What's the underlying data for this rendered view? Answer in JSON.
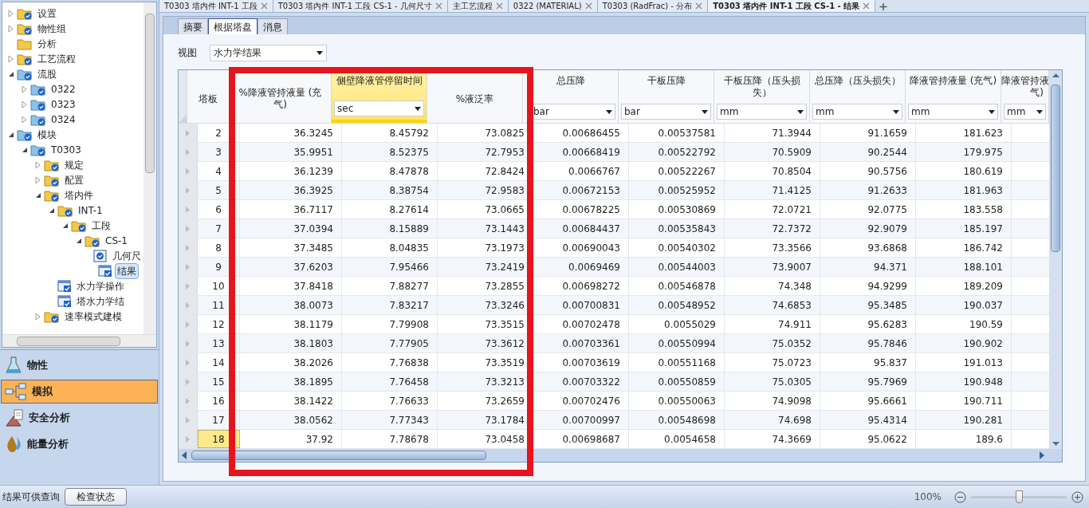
{
  "tree": [
    {
      "label": "设置",
      "kind": "folder-check",
      "expanded": false
    },
    {
      "label": "物性组",
      "kind": "folder-check",
      "expanded": false
    },
    {
      "label": "分析",
      "kind": "folder"
    },
    {
      "label": "工艺流程",
      "kind": "folder-check",
      "expanded": false
    },
    {
      "label": "流股",
      "kind": "folder-blue",
      "expanded": true,
      "children": [
        {
          "label": "0322",
          "kind": "folder-blue",
          "expanded": false
        },
        {
          "label": "0323",
          "kind": "folder-blue",
          "expanded": false
        },
        {
          "label": "0324",
          "kind": "folder-blue",
          "expanded": false
        }
      ]
    },
    {
      "label": "模块",
      "kind": "folder-blue",
      "expanded": true,
      "children": [
        {
          "label": "T0303",
          "kind": "folder-blue",
          "expanded": true,
          "children": [
            {
              "label": "规定",
              "kind": "folder-check",
              "expanded": false
            },
            {
              "label": "配置",
              "kind": "folder-check",
              "expanded": false
            },
            {
              "label": "塔内件",
              "kind": "folder-check",
              "expanded": true,
              "children": [
                {
                  "label": "INT-1",
                  "kind": "folder-check",
                  "expanded": true,
                  "children": [
                    {
                      "label": "工段",
                      "kind": "folder-check",
                      "expanded": true,
                      "children": [
                        {
                          "label": "CS-1",
                          "kind": "folder-check",
                          "expanded": true,
                          "children": [
                            {
                              "label": "几何尺",
                              "kind": "form",
                              "selected": false
                            },
                            {
                              "label": "结果",
                              "kind": "result",
                              "selected": true
                            }
                          ]
                        }
                      ]
                    }
                  ]
                },
                {
                  "label": "水力学操作",
                  "kind": "result",
                  "selected": false
                },
                {
                  "label": "塔水力学结",
                  "kind": "result",
                  "selected": false
                }
              ]
            },
            {
              "label": "速率模式建模",
              "kind": "folder-check",
              "expanded": false
            }
          ]
        }
      ]
    }
  ],
  "nav": [
    {
      "label": "物性",
      "kind": "flask",
      "selected": false
    },
    {
      "label": "模拟",
      "kind": "flowsheet",
      "selected": true
    },
    {
      "label": "安全分析",
      "kind": "safety",
      "selected": false
    },
    {
      "label": "能量分析",
      "kind": "energy",
      "selected": false
    }
  ],
  "doc_tabs": [
    {
      "label": "T0303 塔内件 INT-1 工段",
      "selected": false
    },
    {
      "label": "T0303 塔内件 INT-1 工段 CS-1 - 几何尺寸",
      "selected": false
    },
    {
      "label": "主工艺流程",
      "selected": false
    },
    {
      "label": "0322 (MATERIAL)",
      "selected": false
    },
    {
      "label": "T0303 (RadFrac) - 分布",
      "selected": false
    },
    {
      "label": "T0303 塔内件 INT-1 工段 CS-1 - 结果",
      "selected": true
    }
  ],
  "sub_tabs": [
    {
      "label": "摘要",
      "selected": false
    },
    {
      "label": "根据塔盘",
      "selected": true
    },
    {
      "label": "消息",
      "selected": false
    }
  ],
  "view": {
    "label": "视图",
    "value": "水力学结果"
  },
  "table": {
    "columns": [
      {
        "lines": [
          "塔板"
        ],
        "selected": false
      },
      {
        "lines": [
          "%降液管持液量 (充",
          "气)"
        ],
        "selected": false
      },
      {
        "lines": [
          "侧壁降液管停留时间"
        ],
        "unit": "sec",
        "selected": true
      },
      {
        "lines": [
          "%液泛率"
        ],
        "selected": false
      },
      {
        "lines": [
          "总压降"
        ],
        "unit": "bar",
        "selected": false
      },
      {
        "lines": [
          "干板压降"
        ],
        "unit": "bar",
        "selected": false
      },
      {
        "lines": [
          "干板压降（压头损",
          "失）"
        ],
        "unit": "mm",
        "selected": false
      },
      {
        "lines": [
          "总压降（压头损失）"
        ],
        "unit": "mm",
        "selected": false
      },
      {
        "lines": [
          "降液管持液量 (充气)"
        ],
        "unit": "mm",
        "selected": false
      },
      {
        "lines": [
          "降液管持液",
          "气)"
        ],
        "unit": "mm",
        "selected": false
      }
    ],
    "rows": [
      {
        "selected": false,
        "cells": [
          "2",
          "36.3245",
          "8.45792",
          "73.0825",
          "0.00686455",
          "0.00537581",
          "71.3944",
          "91.1659",
          "181.623"
        ]
      },
      {
        "selected": false,
        "cells": [
          "3",
          "35.9951",
          "8.52375",
          "72.7953",
          "0.00668419",
          "0.00522792",
          "70.5909",
          "90.2544",
          "179.975"
        ]
      },
      {
        "selected": false,
        "cells": [
          "4",
          "36.1239",
          "8.47878",
          "72.8424",
          "0.0066767",
          "0.00522267",
          "70.8504",
          "90.5756",
          "180.619"
        ]
      },
      {
        "selected": false,
        "cells": [
          "5",
          "36.3925",
          "8.38754",
          "72.9583",
          "0.00672153",
          "0.00525952",
          "71.4125",
          "91.2633",
          "181.963"
        ]
      },
      {
        "selected": false,
        "cells": [
          "6",
          "36.7117",
          "8.27614",
          "73.0665",
          "0.00678225",
          "0.00530869",
          "72.0721",
          "92.0775",
          "183.558"
        ]
      },
      {
        "selected": false,
        "cells": [
          "7",
          "37.0394",
          "8.15889",
          "73.1443",
          "0.00684437",
          "0.00535843",
          "72.7372",
          "92.9079",
          "185.197"
        ]
      },
      {
        "selected": false,
        "cells": [
          "8",
          "37.3485",
          "8.04835",
          "73.1973",
          "0.00690043",
          "0.00540302",
          "73.3566",
          "93.6868",
          "186.742"
        ]
      },
      {
        "selected": false,
        "cells": [
          "9",
          "37.6203",
          "7.95466",
          "73.2419",
          "0.0069469",
          "0.00544003",
          "73.9007",
          "94.371",
          "188.101"
        ]
      },
      {
        "selected": false,
        "cells": [
          "10",
          "37.8418",
          "7.88277",
          "73.2855",
          "0.00698272",
          "0.00546878",
          "74.348",
          "94.9299",
          "189.209"
        ]
      },
      {
        "selected": false,
        "cells": [
          "11",
          "38.0073",
          "7.83217",
          "73.3246",
          "0.00700831",
          "0.00548952",
          "74.6853",
          "95.3485",
          "190.037"
        ]
      },
      {
        "selected": false,
        "cells": [
          "12",
          "38.1179",
          "7.79908",
          "73.3515",
          "0.00702478",
          "0.0055029",
          "74.911",
          "95.6283",
          "190.59"
        ]
      },
      {
        "selected": false,
        "cells": [
          "13",
          "38.1803",
          "7.77905",
          "73.3612",
          "0.00703361",
          "0.00550994",
          "75.0352",
          "95.7846",
          "190.902"
        ]
      },
      {
        "selected": false,
        "cells": [
          "14",
          "38.2026",
          "7.76838",
          "73.3519",
          "0.00703619",
          "0.00551168",
          "75.0723",
          "95.837",
          "191.013"
        ]
      },
      {
        "selected": false,
        "cells": [
          "15",
          "38.1895",
          "7.76458",
          "73.3213",
          "0.00703322",
          "0.00550859",
          "75.0305",
          "95.7969",
          "190.948"
        ]
      },
      {
        "selected": false,
        "cells": [
          "16",
          "38.1422",
          "7.76633",
          "73.2659",
          "0.00702476",
          "0.00550063",
          "74.9098",
          "95.6661",
          "190.711"
        ]
      },
      {
        "selected": false,
        "cells": [
          "17",
          "38.0562",
          "7.77343",
          "73.1784",
          "0.00700997",
          "0.00548698",
          "74.698",
          "95.4314",
          "190.281"
        ]
      },
      {
        "selected": true,
        "cells": [
          "18",
          "37.92",
          "7.78678",
          "73.0458",
          "0.00698687",
          "0.0054658",
          "74.3669",
          "95.0622",
          "189.6"
        ]
      }
    ]
  },
  "status_bar": {
    "message": "结果可供查询",
    "button": "检查状态",
    "zoom": "100%",
    "zoom_slider": {
      "level": 0.5
    }
  }
}
